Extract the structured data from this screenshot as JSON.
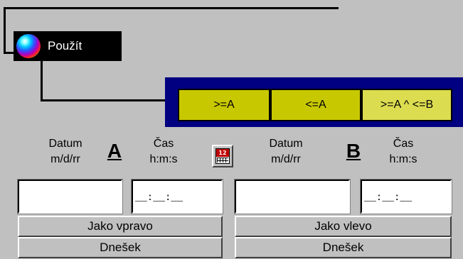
{
  "apply_button": {
    "label": "Použít"
  },
  "mode_buttons": [
    {
      "label": ">=A"
    },
    {
      "label": "<=A"
    },
    {
      "label": ">=A ^ <=B",
      "selected": true
    }
  ],
  "range_a": {
    "letter": "A",
    "date_caption_1": "Datum",
    "date_caption_2": "m/d/rr",
    "time_caption_1": "Čas",
    "time_caption_2": "h:m:s",
    "date_value": "",
    "time_value": "__:__:__",
    "same_as_button": "Jako vpravo",
    "today_button": "Dnešek"
  },
  "range_b": {
    "letter": "B",
    "date_caption_1": "Datum",
    "date_caption_2": "m/d/rr",
    "time_caption_1": "Čas",
    "time_caption_2": "h:m:s",
    "date_value": "",
    "time_value": "__:__:__",
    "same_as_button": "Jako vlevo",
    "today_button": "Dnešek"
  },
  "icons": {
    "apply": "color-orb-icon",
    "calendar": "calendar-icon"
  },
  "colors": {
    "background": "#c0c0c0",
    "mode_panel": "#000080",
    "mode_button": "#c8c800",
    "apply_button": "#000000"
  }
}
